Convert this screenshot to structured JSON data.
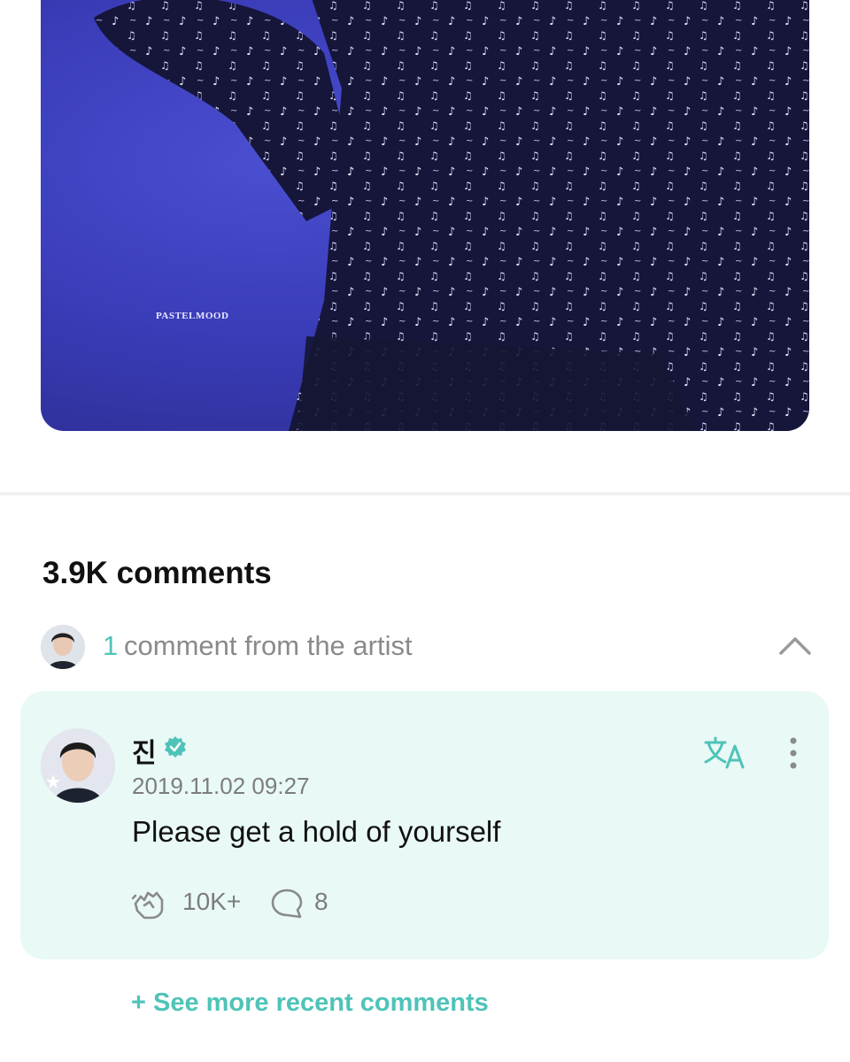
{
  "photo": {
    "watermark": "PASTELMOOD"
  },
  "comments": {
    "count_title": "3.9K comments",
    "artist_summary": {
      "count": "1",
      "label": "comment from the artist"
    }
  },
  "artist_comment": {
    "author": "진",
    "timestamp": "2019.11.02 09:27",
    "text": "Please get a hold of yourself",
    "likes": "10K+",
    "replies": "8"
  },
  "see_more_label": "+ See more recent comments",
  "colors": {
    "accent": "#4fc3b8",
    "card_bg": "#e8f9f6",
    "photo_bg": "#3a3cb8"
  },
  "icons": {
    "verified": "verified-badge-icon",
    "translate": "translate-icon",
    "more": "more-vertical-icon",
    "like": "clap-icon",
    "reply": "chat-bubble-icon",
    "collapse": "chevron-up-icon"
  }
}
